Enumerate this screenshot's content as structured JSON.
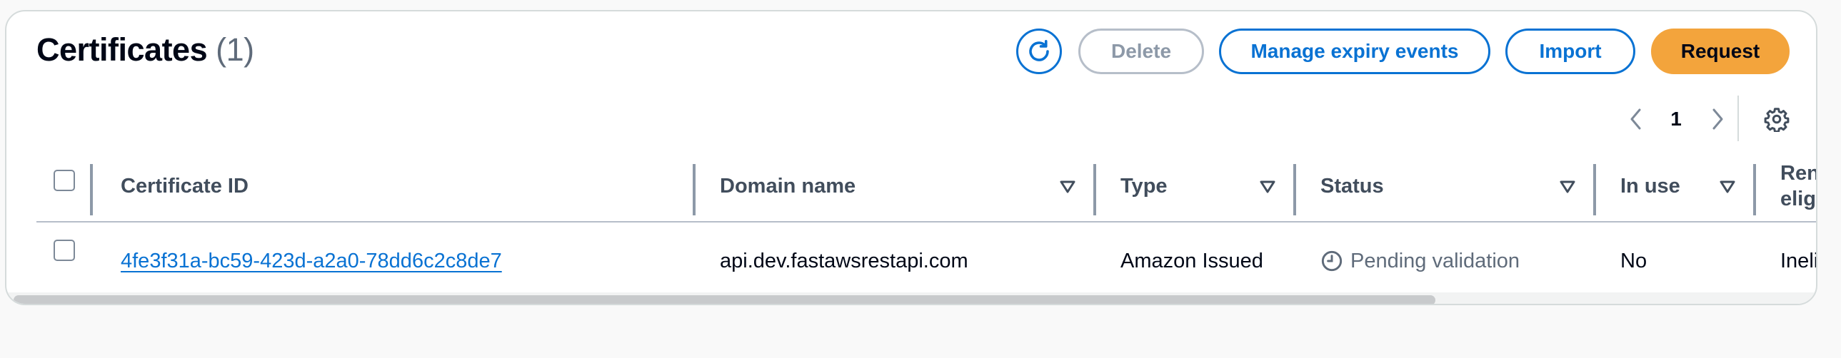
{
  "header": {
    "title": "Certificates",
    "count": "(1)"
  },
  "actions": {
    "refresh_icon": "refresh-icon",
    "delete_label": "Delete",
    "manage_label": "Manage expiry events",
    "import_label": "Import",
    "request_label": "Request"
  },
  "pagination": {
    "current_page": "1",
    "prev_icon": "chevron-left-icon",
    "next_icon": "chevron-right-icon",
    "settings_icon": "gear-icon"
  },
  "table": {
    "columns": [
      {
        "label": "Certificate ID"
      },
      {
        "label": "Domain name"
      },
      {
        "label": "Type"
      },
      {
        "label": "Status"
      },
      {
        "label": "In use"
      },
      {
        "label": "Renewal eligibility"
      }
    ],
    "rows": [
      {
        "certificate_id": "4fe3f31a-bc59-423d-a2a0-78dd6c2c8de7",
        "domain_name": "api.dev.fastawsrestapi.com",
        "type": "Amazon Issued",
        "status": "Pending validation",
        "status_icon": "clock-icon",
        "in_use": "No",
        "renewal_eligibility": "Ineligible"
      }
    ]
  },
  "scrollbar": {
    "visible_fraction": 0.79
  },
  "colors": {
    "accent": "#0972d3",
    "primary_button": "#f3a43c",
    "muted_text": "#5f6b7a"
  }
}
